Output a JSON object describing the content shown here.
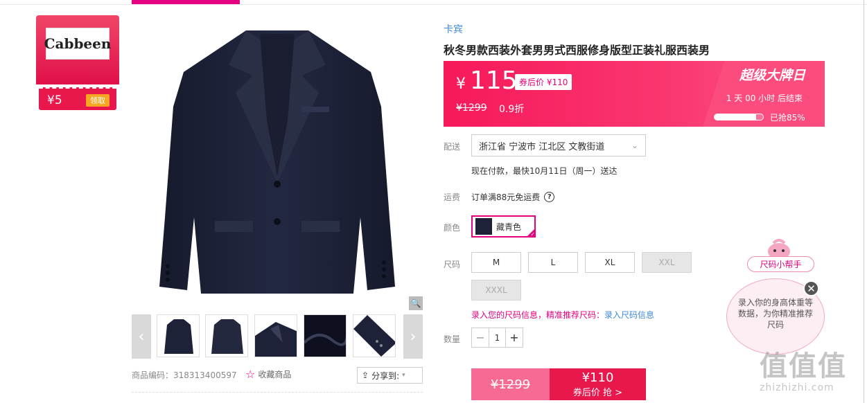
{
  "coupon": {
    "logo_text": "Cabbeen",
    "amount": "¥5",
    "claim_label": "领取"
  },
  "product": {
    "brand": "卡宾",
    "title": "秋冬男款西装外套男男式西服修身版型正装礼服西装男",
    "code_label": "商品编码：318313400597",
    "favorite_label": "收藏商品",
    "share_label": "分享到:"
  },
  "price": {
    "currency": "¥",
    "current": "115",
    "coupon_price": "券后价 ¥110",
    "original": "¥1299",
    "discount": "0.9折"
  },
  "promo": {
    "title": "超级大牌日",
    "countdown": "1  天 00 小时 后结束",
    "sold_label": "已抢85%",
    "sold_fraction": 0.85
  },
  "delivery": {
    "label": "配送",
    "address": "浙江省 宁波市 江北区 文教街道",
    "note": "现在付款，最快10月11日（周一）送达"
  },
  "freight": {
    "label": "运费",
    "text": "订单满88元免运费"
  },
  "color": {
    "label": "颜色",
    "selected": "藏青色"
  },
  "size": {
    "label": "尺码",
    "options": [
      "M",
      "L",
      "XL",
      "XXL",
      "XXXL"
    ],
    "tip": "录入您的尺码信息，精准推荐尺码：",
    "tip_link": "录入尺码信息"
  },
  "quantity": {
    "label": "数量",
    "value": "1",
    "minus": "−",
    "plus": "+"
  },
  "buy": {
    "original": "¥1299",
    "price": "¥110",
    "action": "券后价 抢 >"
  },
  "helper": {
    "title": "尺码小帮手",
    "bubble": "录入你的身高体重等数据，为你精准推荐尺码",
    "close": "✕"
  },
  "watermark": {
    "big": "值值值",
    "small": "zhizhizhi.com"
  },
  "colors": {
    "accent": "#e4007f",
    "link": "#3d88d8",
    "jacket": "#1e2238"
  }
}
